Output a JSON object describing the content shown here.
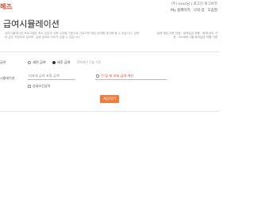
{
  "header": {
    "logo_text": "헤즈",
    "user_line": "(주).xxxx님 | 로그인 로그아웃",
    "meta": [
      "My 홈페이지",
      "나의 방",
      "도움말"
    ]
  },
  "page": {
    "title": "급여시뮬레이션",
    "description": "급여시뮬레이션 프로그램은 최소 임금과 각종 수당을 기준으로 근로자의 예상 급여를 계산해 볼 수 있습니다. 입력한 값은 저장되지 않으며, 실제 급여와 차이가 있을 수 있습니다.",
    "side_info": "급여 계산 기준 안내 · 최저임금 적용 · 현재 년도 기준 · 2018년 1월 최저임금 적용 기준"
  },
  "form": {
    "left_label": "급여",
    "left_label_2": "시뮬레이션",
    "radio_options": [
      {
        "label": "세전 급여",
        "selected": false
      },
      {
        "label": "세후 급여",
        "selected": true
      },
      {
        "label": "2018년 1월 기준",
        "selected": false
      }
    ],
    "field_label": "월 급여",
    "field_placeholder": "비과세 급여 포함 금액",
    "tax_field_label": "간 및 세 과세 급여 계산",
    "detail_checkbox_label": "상세조건입력",
    "calculate_button": "계산하기"
  }
}
